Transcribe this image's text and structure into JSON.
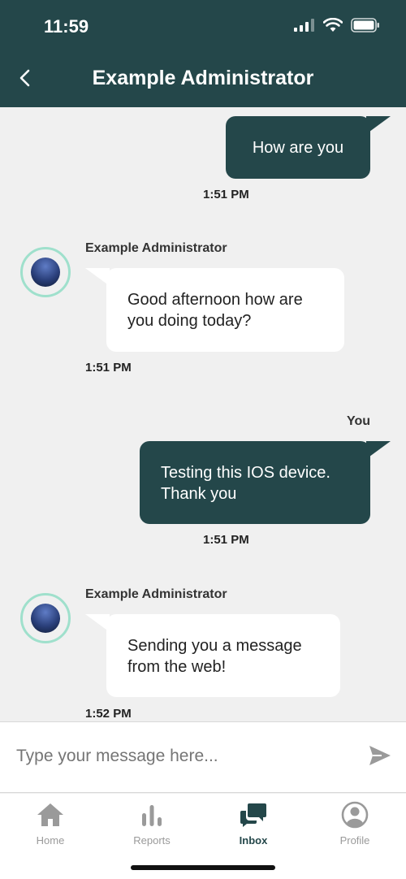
{
  "status_bar": {
    "time": "11:59"
  },
  "header": {
    "title": "Example Administrator"
  },
  "messages": [
    {
      "direction": "outgoing",
      "text": "How are you",
      "time": "1:51 PM"
    },
    {
      "direction": "incoming",
      "sender": "Example Administrator",
      "text": "Good afternoon how are you doing today?",
      "time": "1:51 PM"
    },
    {
      "direction": "outgoing",
      "sender": "You",
      "text": "Testing this IOS device. Thank you",
      "time": "1:51 PM"
    },
    {
      "direction": "incoming",
      "sender": "Example Administrator",
      "text": "Sending you a message from the web!",
      "time": "1:52 PM"
    }
  ],
  "composer": {
    "placeholder": "Type your message here..."
  },
  "tabs": [
    {
      "label": "Home",
      "icon": "home-icon",
      "active": false
    },
    {
      "label": "Reports",
      "icon": "bar-chart-icon",
      "active": false
    },
    {
      "label": "Inbox",
      "icon": "chat-bubbles-icon",
      "active": true
    },
    {
      "label": "Profile",
      "icon": "user-circle-icon",
      "active": false
    }
  ],
  "colors": {
    "primary": "#24474a",
    "avatar_ring": "#9fe0cc",
    "background": "#f0f0f0",
    "inactive_tab": "#9a9a9a"
  }
}
